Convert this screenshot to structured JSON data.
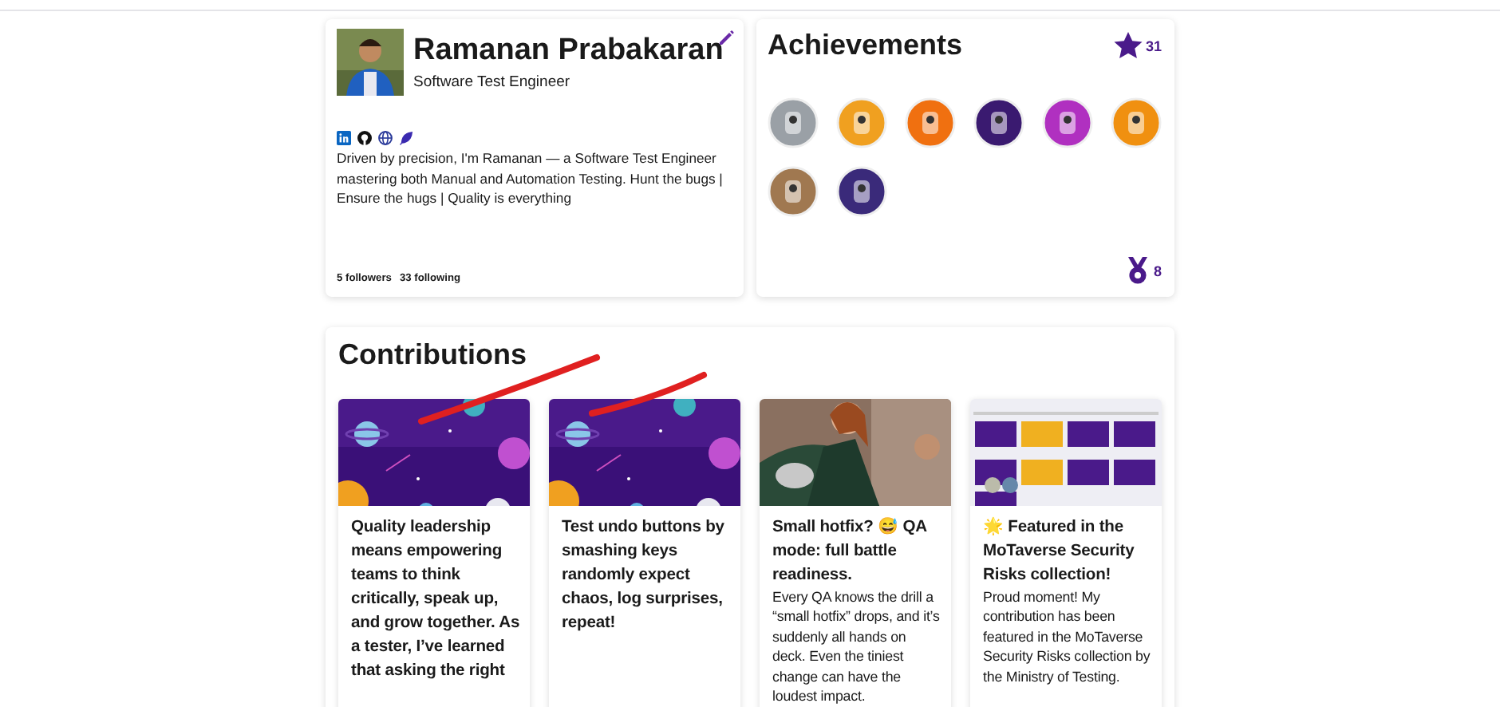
{
  "profile": {
    "name": "Ramanan Prabakaran",
    "title": "Software Test Engineer",
    "links": [
      {
        "kind": "linkedin"
      },
      {
        "kind": "github"
      },
      {
        "kind": "website"
      },
      {
        "kind": "blog"
      }
    ],
    "bio": "Driven by precision, I'm Ramanan — a Software Test Engineer mastering both Manual and Automation Testing. Hunt the bugs | Ensure the hugs | Quality is everything",
    "followers": "5 followers",
    "following": "33 following"
  },
  "achievements": {
    "title": "Achievements",
    "stars_total": "31",
    "medals_total": "8",
    "badges": [
      {
        "color": "#9aa0a6"
      },
      {
        "color": "#f0a020"
      },
      {
        "color": "#f07010"
      },
      {
        "color": "#3a1a70"
      },
      {
        "color": "#b030c0"
      },
      {
        "color": "#f09010"
      },
      {
        "color": "#a07850"
      },
      {
        "color": "#3a2a7a"
      }
    ]
  },
  "contributions": {
    "title": "Contributions",
    "posts": [
      {
        "title": "Quality leadership means empowering teams to think critically, speak up, and grow together. As a tester, I’ve learned that asking the right"
      },
      {
        "title": "Test undo buttons by smashing keys randomly expect chaos, log surprises, repeat!"
      },
      {
        "title": "Small hotfix? 😅 QA mode: full battle readiness.",
        "body": "Every QA knows the drill a “small hotfix” drops, and it’s suddenly all hands on deck. Even the tiniest change can have the loudest impact."
      },
      {
        "title": "🌟 Featured in the MoTaverse Security Risks collection!",
        "body": "Proud moment! My contribution has been featured in the MoTaverse Security Risks collection by the Ministry of Testing."
      }
    ]
  }
}
